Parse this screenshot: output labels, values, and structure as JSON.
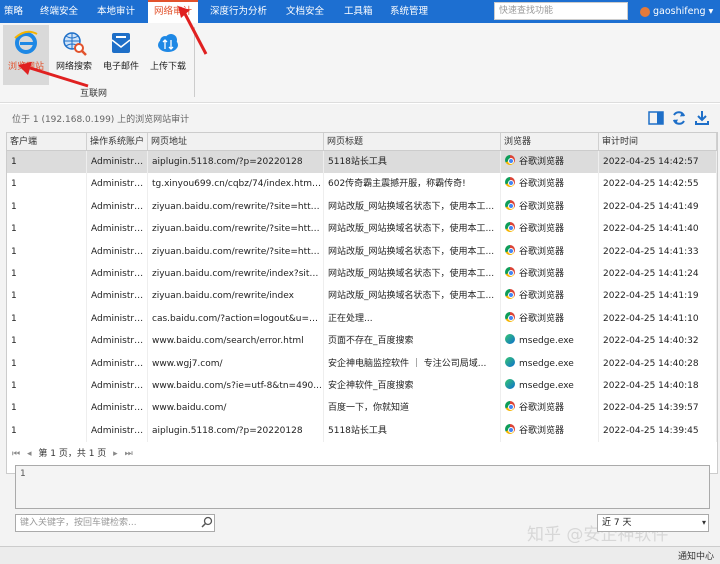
{
  "menubar": {
    "items": [
      "策略",
      "终端安全",
      "本地审计",
      "网络审计",
      "深度行为分析",
      "文档安全",
      "工具箱",
      "系统管理"
    ],
    "active": "网络审计",
    "search_placeholder": "快速查找功能",
    "user": "gaoshifeng"
  },
  "ribbon": {
    "buttons": [
      {
        "label": "浏览网站",
        "icon": "ie-browser-icon"
      },
      {
        "label": "网络搜索",
        "icon": "globe-search-icon"
      },
      {
        "label": "电子邮件",
        "icon": "email-icon"
      },
      {
        "label": "上传下载",
        "icon": "cloud-transfer-icon"
      }
    ],
    "active": "浏览网站",
    "group_label": "互联网"
  },
  "location": "位于 1 (192.168.0.199) 上的浏览网站审计",
  "table": {
    "headers": [
      "客户端",
      "操作系统账户",
      "网页地址",
      "网页标题",
      "浏览器",
      "审计时间"
    ],
    "rows": [
      [
        "1",
        "Administra...",
        "aiplugin.5118.com/?p=20220128",
        "5118站长工具",
        "谷歌浏览器",
        "2022-04-25 14:42:57"
      ],
      [
        "1",
        "Administra...",
        "tg.xinyou699.cn/cqbz/74/index.html...",
        "602传奇霸主震撼开服，称霸传奇!",
        "谷歌浏览器",
        "2022-04-25 14:42:55"
      ],
      [
        "1",
        "Administra...",
        "ziyuan.baidu.com/rewrite/?site=http...",
        "网站改版_网站换域名状态下，使用本工...",
        "谷歌浏览器",
        "2022-04-25 14:41:49"
      ],
      [
        "1",
        "Administra...",
        "ziyuan.baidu.com/rewrite/?site=http...",
        "网站改版_网站换域名状态下，使用本工...",
        "谷歌浏览器",
        "2022-04-25 14:41:40"
      ],
      [
        "1",
        "Administra...",
        "ziyuan.baidu.com/rewrite/?site=http...",
        "网站改版_网站换域名状态下，使用本工...",
        "谷歌浏览器",
        "2022-04-25 14:41:33"
      ],
      [
        "1",
        "Administra...",
        "ziyuan.baidu.com/rewrite/index?site...",
        "网站改版_网站换域名状态下，使用本工...",
        "谷歌浏览器",
        "2022-04-25 14:41:24"
      ],
      [
        "1",
        "Administra...",
        "ziyuan.baidu.com/rewrite/index",
        "网站改版_网站换域名状态下，使用本工...",
        "谷歌浏览器",
        "2022-04-25 14:41:19"
      ],
      [
        "1",
        "Administra...",
        "cas.baidu.com/?action=logout&u=h...",
        "正在处理...",
        "谷歌浏览器",
        "2022-04-25 14:41:10"
      ],
      [
        "1",
        "Administra...",
        "www.baidu.com/search/error.html",
        "页面不存在_百度搜索",
        "msedge.exe",
        "2022-04-25 14:40:32"
      ],
      [
        "1",
        "Administra...",
        "www.wgj7.com/",
        "安企神电脑监控软件 ｜ 专注公司局域...",
        "msedge.exe",
        "2022-04-25 14:40:28"
      ],
      [
        "1",
        "Administra...",
        "www.baidu.com/s?ie=utf-8&tn=490...",
        "安企神软件_百度搜索",
        "msedge.exe",
        "2022-04-25 14:40:18"
      ],
      [
        "1",
        "Administra...",
        "www.baidu.com/",
        "百度一下，你就知道",
        "谷歌浏览器",
        "2022-04-25 14:39:57"
      ],
      [
        "1",
        "Administra...",
        "aiplugin.5118.com/?p=20220128",
        "5118站长工具",
        "谷歌浏览器",
        "2022-04-25 14:39:45"
      ]
    ]
  },
  "pager": {
    "text": "第 1 页，共 1 页"
  },
  "detail_text": "1",
  "keyword_placeholder": "键入关键字，按回车键检索...",
  "range_value": "近 7 天",
  "watermark": "知乎 @安企神软件",
  "status": {
    "notify": "通知中心"
  }
}
